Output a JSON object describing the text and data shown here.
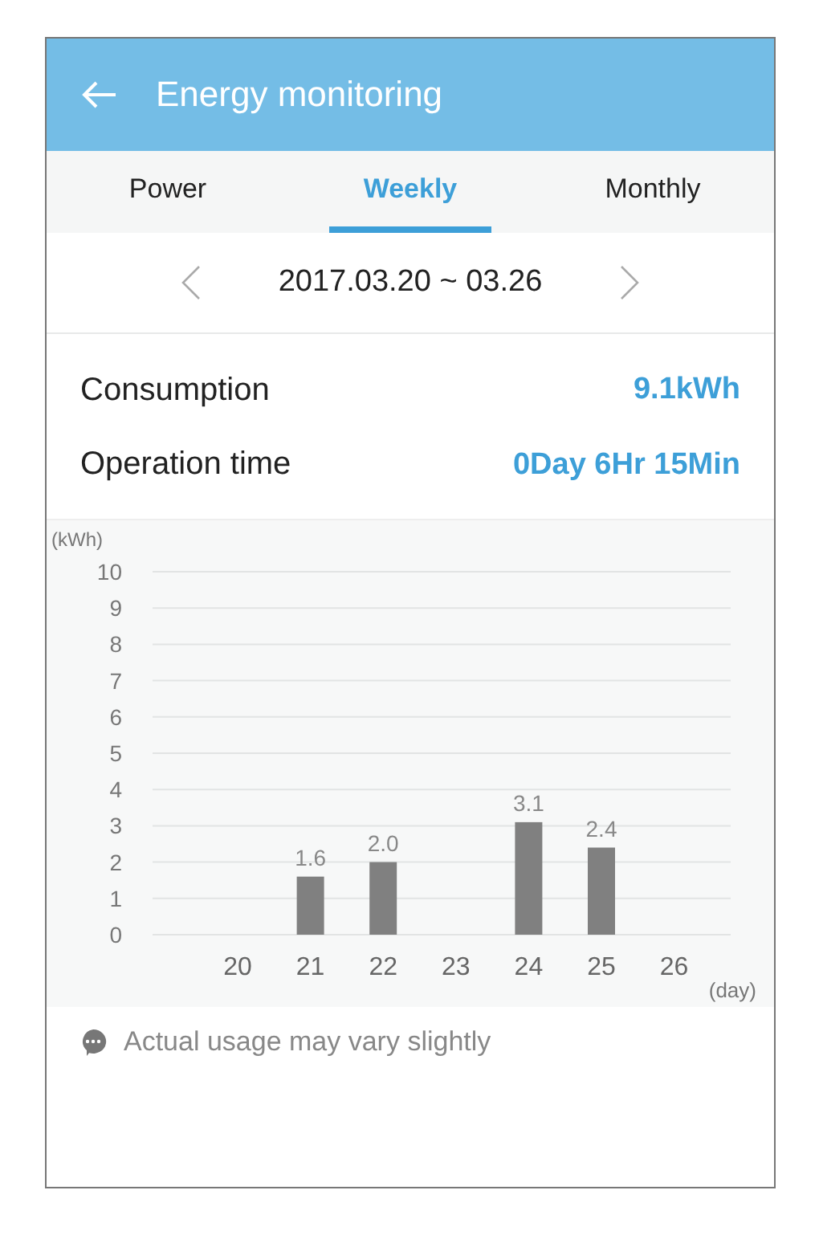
{
  "header": {
    "title": "Energy monitoring"
  },
  "tabs": [
    {
      "label": "Power",
      "selected": false
    },
    {
      "label": "Weekly",
      "selected": true
    },
    {
      "label": "Monthly",
      "selected": false
    }
  ],
  "date_range": "2017.03.20 ~ 03.26",
  "stats": [
    {
      "label": "Consumption",
      "value": "9.1kWh"
    },
    {
      "label": "Operation time",
      "value": "0Day 6Hr 15Min"
    }
  ],
  "chart": {
    "chart_data": {
      "type": "bar",
      "xlabel": "(day)",
      "ylabel": "(kWh)",
      "categories": [
        "20",
        "21",
        "22",
        "23",
        "24",
        "25",
        "26"
      ],
      "values": [
        null,
        1.6,
        2.0,
        null,
        3.1,
        2.4,
        null
      ],
      "ylim": [
        0,
        10
      ],
      "yticks": [
        0,
        1,
        2,
        3,
        4,
        5,
        6,
        7,
        8,
        9,
        10
      ],
      "grid": true,
      "value_labels": [
        null,
        "1.6",
        "2.0",
        null,
        "3.1",
        "2.4",
        null
      ]
    }
  },
  "note": "Actual usage may vary slightly"
}
